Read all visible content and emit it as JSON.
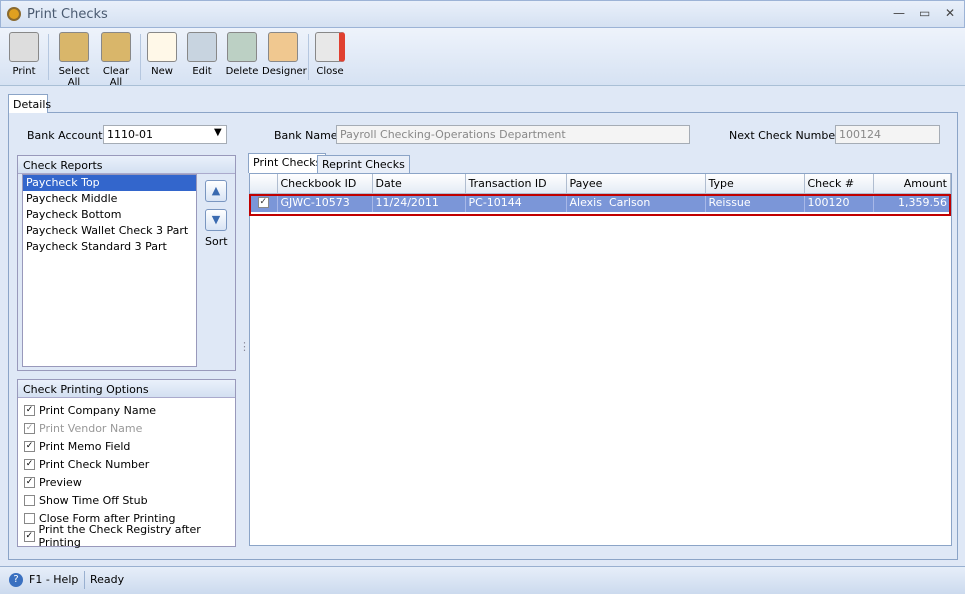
{
  "window": {
    "title": "Print Checks"
  },
  "toolbar": {
    "print": "Print",
    "select_all": "Select All",
    "clear_all": "Clear All",
    "new": "New",
    "edit": "Edit",
    "delete": "Delete",
    "designer": "Designer",
    "close": "Close"
  },
  "tabs": {
    "details": "Details"
  },
  "form": {
    "bank_account_label": "Bank Account",
    "bank_account": "1110-01",
    "bank_name_label": "Bank Name",
    "bank_name": "Payroll Checking-Operations Department",
    "next_check_label": "Next Check Number",
    "next_check": "100124"
  },
  "check_reports": {
    "title": "Check Reports",
    "items": [
      "Paycheck Top",
      "Paycheck Middle",
      "Paycheck Bottom",
      "Paycheck Wallet Check 3 Part",
      "Paycheck Standard 3 Part"
    ],
    "sort": "Sort"
  },
  "options": {
    "title": "Check Printing Options",
    "items": [
      {
        "label": "Print Company Name",
        "checked": true
      },
      {
        "label": "Print Vendor Name",
        "checked": true,
        "disabled": true
      },
      {
        "label": "Print Memo Field",
        "checked": true
      },
      {
        "label": "Print Check Number",
        "checked": true
      },
      {
        "label": "Preview",
        "checked": true
      },
      {
        "label": "Show Time Off Stub",
        "checked": false
      },
      {
        "label": "Close Form after Printing",
        "checked": false
      },
      {
        "label": "Print the Check Registry after Printing",
        "checked": true
      }
    ]
  },
  "grid": {
    "tabs": [
      "Print Checks",
      "Reprint Checks"
    ],
    "columns": [
      "Checkbook ID",
      "Date",
      "Transaction ID",
      "Payee",
      "Type",
      "Check #",
      "Amount"
    ],
    "rows": [
      [
        "GJWC-10573",
        "11/24/2011",
        "PC-10144",
        "Alexis  Carlson",
        "Reissue",
        "100120",
        "1,359.56"
      ]
    ]
  },
  "status": {
    "help": "F1 - Help",
    "state": "Ready"
  }
}
